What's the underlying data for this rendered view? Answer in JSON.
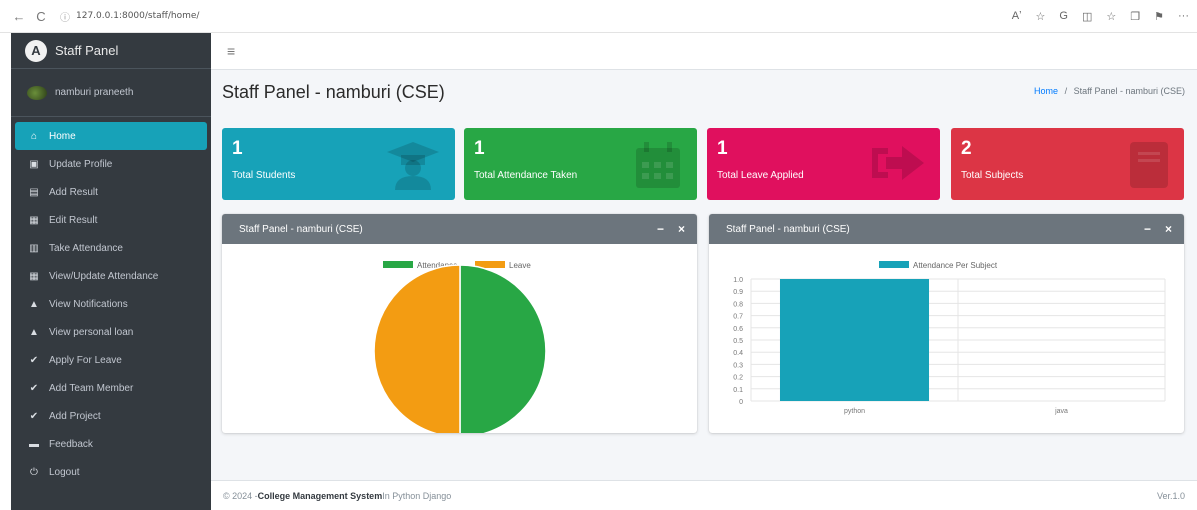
{
  "browser": {
    "url": "127.0.0.1:8000/staff/home/",
    "back_glyph": "←",
    "reload_glyph": "C",
    "info_glyph": "ⓘ",
    "menu_glyph": "···",
    "right_icons": [
      "Aʼ",
      "☆",
      "G",
      "◫",
      "☆",
      "❐",
      "⚑"
    ]
  },
  "sidebar": {
    "brand": "Staff Panel",
    "brand_logo_letter": "A",
    "user_name": "namburi praneeth",
    "items": [
      {
        "label": "Home",
        "icon": "home-icon",
        "glyph": "⌂",
        "active": true
      },
      {
        "label": "Update Profile",
        "icon": "id-card-icon",
        "glyph": "▣"
      },
      {
        "label": "Add Result",
        "icon": "file-icon",
        "glyph": "▤"
      },
      {
        "label": "Edit Result",
        "icon": "grid-icon",
        "glyph": "▦"
      },
      {
        "label": "Take Attendance",
        "icon": "calendar-icon",
        "glyph": "▥"
      },
      {
        "label": "View/Update Attendance",
        "icon": "grid-icon",
        "glyph": "▦"
      },
      {
        "label": "View Notifications",
        "icon": "bell-icon",
        "glyph": "▲"
      },
      {
        "label": "View personal loan",
        "icon": "bell-icon",
        "glyph": "▲"
      },
      {
        "label": "Apply For Leave",
        "icon": "check-icon",
        "glyph": "✔"
      },
      {
        "label": "Add Team Member",
        "icon": "check-icon",
        "glyph": "✔"
      },
      {
        "label": "Add Project",
        "icon": "check-icon",
        "glyph": "✔"
      },
      {
        "label": "Feedback",
        "icon": "comment-icon",
        "glyph": "▬"
      },
      {
        "label": "Logout",
        "icon": "power-icon",
        "glyph": "⏻"
      }
    ]
  },
  "topnav": {
    "hamburger_glyph": "≡"
  },
  "page": {
    "title": "Staff Panel - namburi (CSE)",
    "breadcrumb_home": "Home",
    "breadcrumb_sep": "/",
    "breadcrumb_current": "Staff Panel - namburi (CSE)"
  },
  "stats": [
    {
      "value": "1",
      "label": "Total Students",
      "color": "#17a2b8",
      "icon": "graduate-icon"
    },
    {
      "value": "1",
      "label": "Total Attendance Taken",
      "color": "#28a745",
      "icon": "calendar-icon"
    },
    {
      "value": "1",
      "label": "Total Leave Applied",
      "color": "#e0105e",
      "icon": "arrow-right-icon"
    },
    {
      "value": "2",
      "label": "Total Subjects",
      "color": "#dc3545",
      "icon": "book-icon"
    }
  ],
  "cards": {
    "left_title": "Staff Panel - namburi (CSE)",
    "right_title": "Staff Panel - namburi (CSE)",
    "minimize_glyph": "−",
    "close_glyph": "×"
  },
  "chart_data": [
    {
      "type": "pie",
      "legend": [
        "Attendance",
        "Leave"
      ],
      "values": [
        1,
        1
      ],
      "colors": [
        "#28a745",
        "#f39c12"
      ],
      "legend_position": "top"
    },
    {
      "type": "bar",
      "series": [
        {
          "name": "Attendance Per Subject",
          "values": [
            1,
            0
          ]
        }
      ],
      "categories": [
        "python",
        "java"
      ],
      "ylim": [
        0,
        1.0
      ],
      "yticks": [
        "0",
        "0.1",
        "0.2",
        "0.3",
        "0.4",
        "0.5",
        "0.6",
        "0.7",
        "0.8",
        "0.9",
        "1.0"
      ],
      "color": "#17a2b8",
      "grid": true,
      "legend_position": "top"
    }
  ],
  "footer": {
    "copyright": "© 2024 - ",
    "brand": "College Management System",
    "suffix": " In Python Django",
    "version": "Ver.1.0"
  }
}
